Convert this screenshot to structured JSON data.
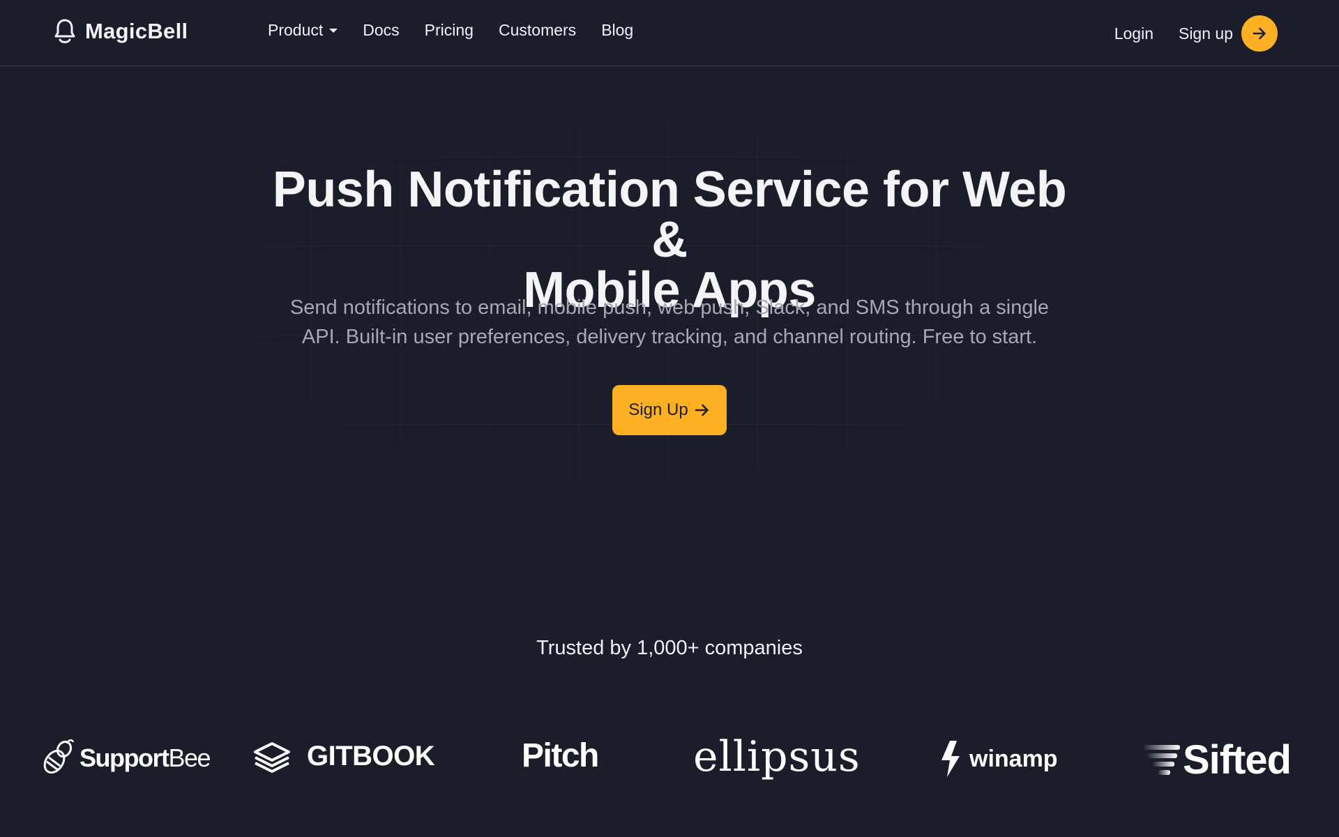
{
  "nav": {
    "brand": "MagicBell",
    "links": [
      {
        "label": "Product",
        "has_dropdown": true
      },
      {
        "label": "Docs"
      },
      {
        "label": "Pricing"
      },
      {
        "label": "Customers"
      },
      {
        "label": "Blog"
      }
    ],
    "login": "Login",
    "signup": "Sign up"
  },
  "hero": {
    "title_line1": "Push Notification Service for Web &",
    "title_line2": "Mobile Apps",
    "subtitle_line1": "Send notifications to email, mobile push, web push, Slack, and SMS through a single",
    "subtitle_line2": "API. Built-in user preferences, delivery tracking, and channel routing. Free to start.",
    "cta": "Sign Up"
  },
  "trusted": {
    "text": "Trusted by 1,000+ companies",
    "logos": [
      {
        "name": "SupportBee",
        "part1": "Support",
        "part2": "Bee"
      },
      {
        "name": "GITBOOK",
        "text": "GITBOOK"
      },
      {
        "name": "Pitch",
        "text": "Pitch"
      },
      {
        "name": "ellipsus",
        "text": "ellipsus"
      },
      {
        "name": "winamp",
        "text": "winamp"
      },
      {
        "name": "Sifted",
        "text": "Sifted"
      }
    ]
  },
  "colors": {
    "background": "#1b1d2a",
    "accent": "#fdb022",
    "text": "#f1f1f4",
    "muted": "#a6a8b5",
    "border": "#3a3d4c"
  },
  "icons": {
    "brand": "bell-icon",
    "dropdown": "caret-down-icon",
    "arrow": "arrow-right-icon"
  }
}
